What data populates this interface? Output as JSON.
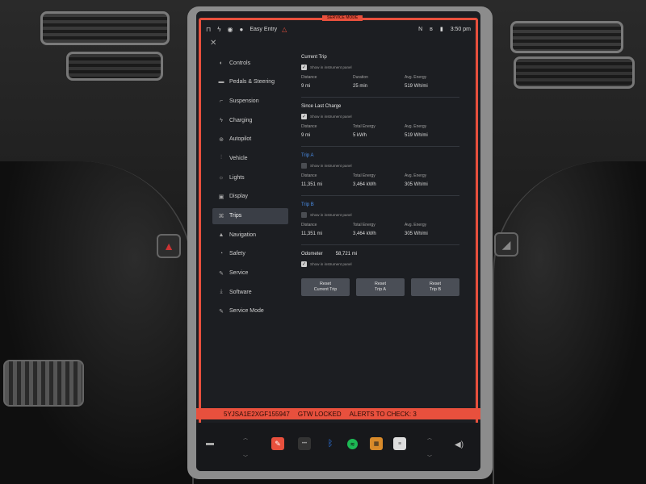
{
  "status_bar": {
    "profile": "Easy Entry",
    "time": "3:50 pm"
  },
  "service_tag": "SERVICE MODE",
  "sidebar": {
    "items": [
      {
        "label": "Controls",
        "icon": "toggle-icon"
      },
      {
        "label": "Pedals & Steering",
        "icon": "car-icon"
      },
      {
        "label": "Suspension",
        "icon": "suspension-icon"
      },
      {
        "label": "Charging",
        "icon": "bolt-icon"
      },
      {
        "label": "Autopilot",
        "icon": "steering-wheel-icon"
      },
      {
        "label": "Vehicle",
        "icon": "sliders-icon"
      },
      {
        "label": "Lights",
        "icon": "sun-icon"
      },
      {
        "label": "Display",
        "icon": "display-icon"
      },
      {
        "label": "Trips",
        "icon": "trips-icon"
      },
      {
        "label": "Navigation",
        "icon": "navigation-icon"
      },
      {
        "label": "Safety",
        "icon": "shield-icon"
      },
      {
        "label": "Service",
        "icon": "wrench-icon"
      },
      {
        "label": "Software",
        "icon": "download-icon"
      },
      {
        "label": "Service Mode",
        "icon": "wrench-icon"
      }
    ],
    "active": "Trips"
  },
  "trips": {
    "current": {
      "title": "Current Trip",
      "show_label": "Show in instrument panel",
      "labels": [
        "Distance",
        "Duration",
        "Avg. Energy"
      ],
      "values": [
        "9 mi",
        "25 min",
        "519 Wh/mi"
      ]
    },
    "since_charge": {
      "title": "Since Last Charge",
      "show_label": "Show in instrument panel",
      "labels": [
        "Distance",
        "Total Energy",
        "Avg. Energy"
      ],
      "values": [
        "9 mi",
        "5 kWh",
        "519 Wh/mi"
      ]
    },
    "trip_a": {
      "title": "Trip A",
      "show_label": "Show in instrument panel",
      "labels": [
        "Distance",
        "Total Energy",
        "Avg. Energy"
      ],
      "values": [
        "11,351 mi",
        "3,464 kWh",
        "305 Wh/mi"
      ]
    },
    "trip_b": {
      "title": "Trip B",
      "show_label": "Show in instrument panel",
      "labels": [
        "Distance",
        "Total Energy",
        "Avg. Energy"
      ],
      "values": [
        "11,351 mi",
        "3,464 kWh",
        "305 Wh/mi"
      ]
    },
    "odometer": {
      "label": "Odometer",
      "value": "58,721 mi",
      "show_label": "Show in instrument panel"
    },
    "reset_current": {
      "line1": "Reset",
      "line2": "Current Trip"
    },
    "reset_a": {
      "line1": "Reset",
      "line2": "Trip A"
    },
    "reset_b": {
      "line1": "Reset",
      "line2": "Trip B"
    }
  },
  "alert_bar": {
    "vin": "5YJSA1E2XGF155947",
    "gtw": "GTW LOCKED",
    "alerts": "ALERTS TO CHECK: 3"
  },
  "colors": {
    "accent_red": "#e8503d",
    "trip_blue": "#4a8ee8"
  }
}
